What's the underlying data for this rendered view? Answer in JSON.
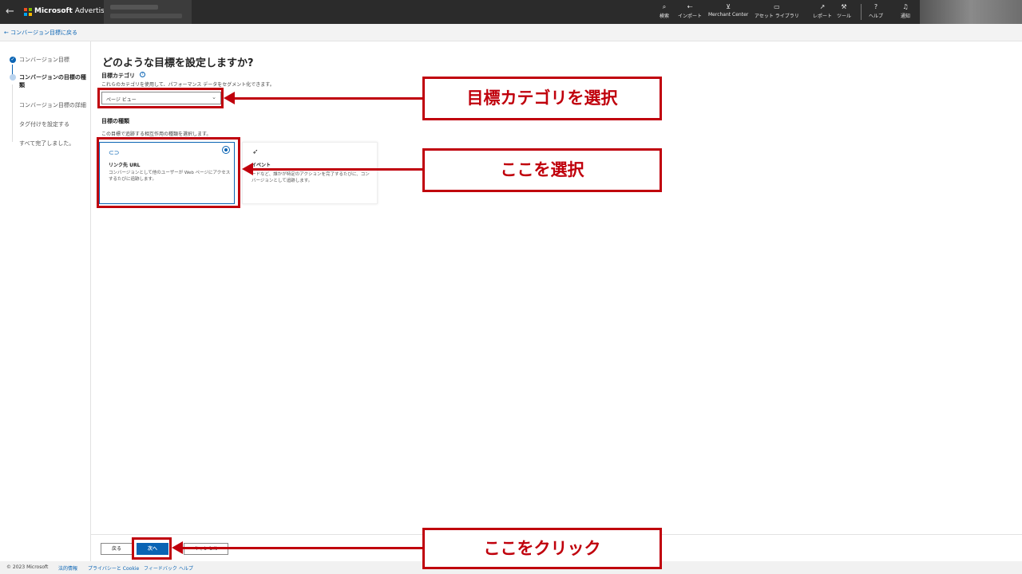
{
  "topbar": {
    "brand_name": "Microsoft",
    "brand_product": "Advertising",
    "logo_colors": [
      "#f25022",
      "#7fba00",
      "#00a4ef",
      "#ffb900"
    ],
    "nav": [
      {
        "label": "検索",
        "icon": "search-icon"
      },
      {
        "label": "インポート",
        "icon": "import-icon"
      },
      {
        "label": "Merchant Center",
        "icon": "cart-icon"
      },
      {
        "label": "アセット ライブラリ",
        "icon": "asset-library-icon"
      },
      {
        "label": "レポート",
        "icon": "chart-icon"
      },
      {
        "label": "ツール",
        "icon": "wrench-icon"
      },
      {
        "label": "ヘルプ",
        "icon": "question-icon"
      },
      {
        "label": "通知",
        "icon": "bell-icon"
      }
    ]
  },
  "breadcrumb": {
    "label": "コンバージョン目標に戻る"
  },
  "steps": [
    {
      "label": "コンバージョン目標",
      "state": "done"
    },
    {
      "label": "コンバージョンの目標の種類",
      "state": "current"
    },
    {
      "label": "コンバージョン目標の詳細",
      "state": "pending"
    },
    {
      "label": "タグ付けを設定する",
      "state": "pending"
    },
    {
      "label": "すべて完了しました。",
      "state": "pending"
    }
  ],
  "main": {
    "title": "どのような目標を設定しますか?",
    "category_label": "目標カテゴリ",
    "category_desc": "これらのカテゴリを使用して、パフォーマンス データをセグメント化できます。",
    "category_value": "ページ ビュー",
    "type_label": "目標の種類",
    "type_desc": "この目標で追跡する相互作用の種類を選択します。",
    "cards": [
      {
        "title": "リンク先 URL",
        "desc": "コンバージョンとして他のユーザーが Web ページにアクセスするたびに追跡します。",
        "selected": true
      },
      {
        "title": "イベント",
        "desc": "ードなど、誰かが特定のアクションを完了するたびに、コンバージョンとして追跡します。",
        "selected": false
      }
    ]
  },
  "buttons": {
    "back": "戻る",
    "next": "次へ",
    "cancel": "キャンセル"
  },
  "footer": {
    "copyright": "© 2023 Microsoft",
    "links": [
      "法的情報",
      "プライバシーと Cookie",
      "フィードバック",
      "ヘルプ"
    ]
  },
  "annotations": {
    "callout1": "目標カテゴリを選択",
    "callout2": "ここを選択",
    "callout3": "ここをクリック",
    "color": "#c0000c"
  }
}
